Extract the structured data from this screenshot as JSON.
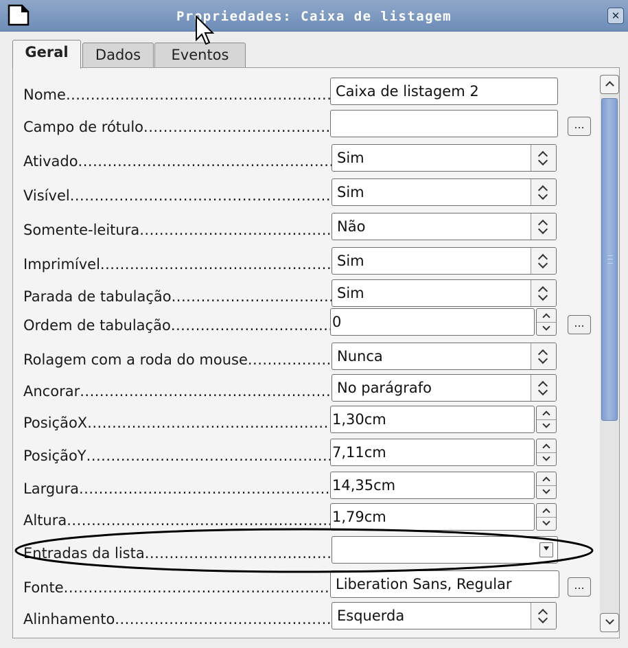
{
  "window": {
    "title": "Propriedades: Caixa de listagem",
    "close_glyph": "✕"
  },
  "tabs": [
    {
      "label": "Geral",
      "active": true
    },
    {
      "label": "Dados",
      "active": false
    },
    {
      "label": "Eventos",
      "active": false
    }
  ],
  "properties": [
    {
      "label": "Nome",
      "value": "Caixa de listagem 2",
      "control": "text"
    },
    {
      "label": "Campo de rótulo",
      "value": "",
      "control": "text-button"
    },
    {
      "label": "Ativado",
      "value": "Sim",
      "control": "combo"
    },
    {
      "label": "Visível",
      "value": "Sim",
      "control": "combo"
    },
    {
      "label": "Somente-leitura",
      "value": "Não",
      "control": "combo"
    },
    {
      "label": "Imprimível",
      "value": "Sim",
      "control": "combo"
    },
    {
      "label": "Parada de tabulação",
      "value": "Sim",
      "control": "combo"
    },
    {
      "label": "Ordem de tabulação",
      "value": "0",
      "control": "spin-button"
    },
    {
      "label": "Rolagem com a roda do mouse",
      "value": "Nunca",
      "control": "combo"
    },
    {
      "label": "Ancorar",
      "value": "No parágrafo",
      "control": "combo"
    },
    {
      "label": "PosiçãoX",
      "value": "1,30cm",
      "control": "spin"
    },
    {
      "label": "PosiçãoY",
      "value": "7,11cm",
      "control": "spin"
    },
    {
      "label": "Largura",
      "value": "14,35cm",
      "control": "spin"
    },
    {
      "label": "Altura",
      "value": "1,79cm",
      "control": "spin"
    },
    {
      "label": "Entradas da lista",
      "value": "",
      "control": "dropdown"
    },
    {
      "label": "Fonte",
      "value": "Liberation Sans, Regular",
      "control": "text-button"
    },
    {
      "label": "Alinhamento",
      "value": "Esquerda",
      "control": "combo"
    }
  ],
  "buttons": {
    "ellipsis": "..."
  },
  "icons": {
    "app": "document-icon",
    "cursor": "mouse-pointer-icon"
  },
  "colors": {
    "titlebar": "#7b97bf",
    "scroll_thumb": "#8aa8d4",
    "highlight": "#000000"
  }
}
